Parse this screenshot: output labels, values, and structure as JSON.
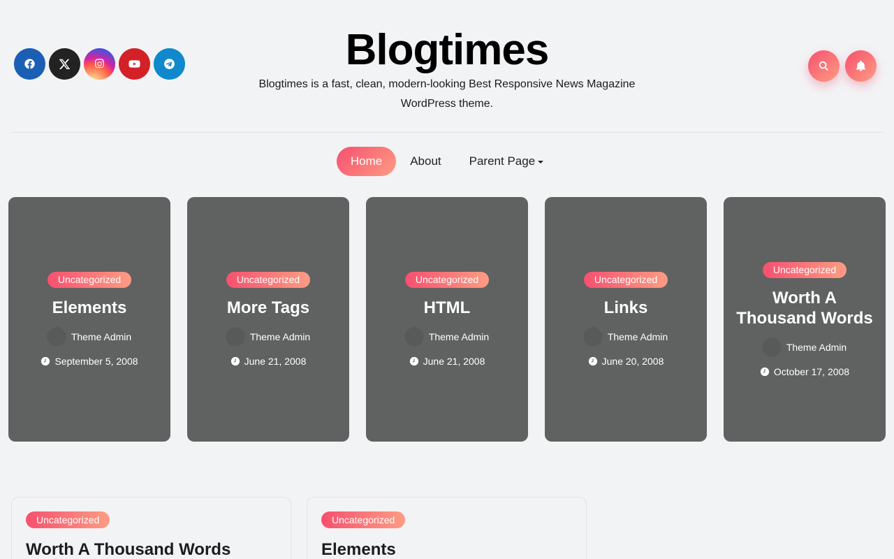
{
  "site": {
    "title": "Blogtimes",
    "description": "Blogtimes is a fast, clean, modern-looking Best Responsive News Magazine WordPress theme."
  },
  "socials": [
    {
      "name": "facebook",
      "icon": "facebook-icon",
      "color": "#1a5fb4"
    },
    {
      "name": "x",
      "icon": "x-icon",
      "color": "#222222"
    },
    {
      "name": "instagram",
      "icon": "instagram-icon",
      "color": "#c13584"
    },
    {
      "name": "youtube",
      "icon": "youtube-icon",
      "color": "#d42027"
    },
    {
      "name": "telegram",
      "icon": "telegram-icon",
      "color": "#0f88cc"
    }
  ],
  "nav": {
    "home": "Home",
    "about": "About",
    "parent": "Parent Page"
  },
  "colors": {
    "accent_start": "#f7506f",
    "accent_end": "#fd9c83",
    "card_bg": "#606161"
  },
  "cards": [
    {
      "category": "Uncategorized",
      "title": "Elements",
      "author": "Theme Admin",
      "date": "September 5, 2008"
    },
    {
      "category": "Uncategorized",
      "title": "More Tags",
      "author": "Theme Admin",
      "date": "June 21, 2008"
    },
    {
      "category": "Uncategorized",
      "title": "HTML",
      "author": "Theme Admin",
      "date": "June 21, 2008"
    },
    {
      "category": "Uncategorized",
      "title": "Links",
      "author": "Theme Admin",
      "date": "June 20, 2008"
    },
    {
      "category": "Uncategorized",
      "title": "Worth A Thousand Words",
      "author": "Theme Admin",
      "date": "October 17, 2008"
    }
  ],
  "posts": [
    {
      "category": "Uncategorized",
      "title": "Worth A Thousand Words"
    },
    {
      "category": "Uncategorized",
      "title": "Elements"
    }
  ]
}
